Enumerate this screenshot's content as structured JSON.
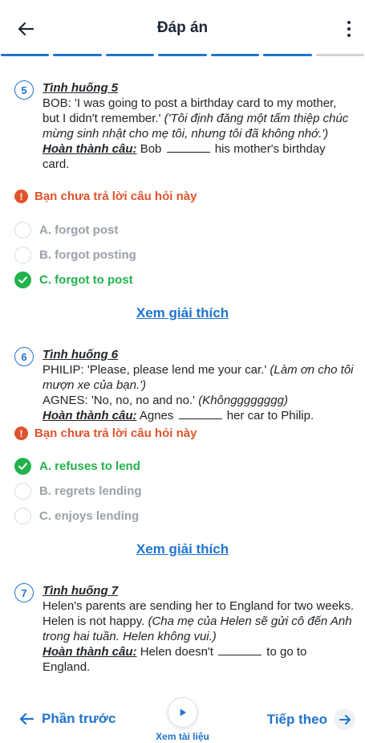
{
  "header": {
    "title": "Đáp án"
  },
  "progress": {
    "total_segments": 7,
    "completed_segments": 6
  },
  "warning_text": "Bạn chưa trả lời câu hỏi này",
  "explain_label": "Xem giải thích",
  "complete_label": "Hoàn thành câu:",
  "questions": [
    {
      "number": "5",
      "title": "Tình huống 5",
      "text_plain": "BOB: 'I was going to post a birthday card to my mother, but I didn't remember.'",
      "text_italic": "('Tôi định đăng một tấm thiệp chúc mừng sinh nhật cho mẹ tôi, nhưng tôi đã không nhớ.')",
      "complete_before": "Bob",
      "complete_after": "his mother's birthday card.",
      "options": [
        {
          "label": "A. forgot post",
          "correct": false
        },
        {
          "label": "B. forgot posting",
          "correct": false
        },
        {
          "label": "C. forgot to post",
          "correct": true
        }
      ]
    },
    {
      "number": "6",
      "title": "Tình huống 6",
      "line1_plain": "PHILIP: 'Please, please lend me your car.'",
      "line1_italic": "(Làm ơn cho tôi mượn xe của bạn.')",
      "line2_plain": "AGNES: 'No, no, no and no.'",
      "line2_italic": "(Khôngggggggg)",
      "complete_before": "Agnes",
      "complete_after": "her car to Philip.",
      "options": [
        {
          "label": "A. refuses to lend",
          "correct": true
        },
        {
          "label": "B. regrets lending",
          "correct": false
        },
        {
          "label": "C. enjoys lending",
          "correct": false
        }
      ]
    },
    {
      "number": "7",
      "title": "Tình huống 7",
      "text_plain": "Helen's parents are sending her to England for two weeks. Helen is not happy.",
      "text_italic": "(Cha mẹ của Helen sẽ gửi cô đến Anh trong hai tuần. Helen không vui.)",
      "complete_before": "Helen doesn't",
      "complete_after": "to go to England."
    }
  ],
  "footer": {
    "prev_label": "Phần trước",
    "doc_label": "Xem tài liệu",
    "next_label": "Tiếp theo"
  },
  "colors": {
    "accent": "#1f74cf",
    "correct": "#22b24c",
    "warning": "#e0532d",
    "muted": "#9aa1aa"
  }
}
